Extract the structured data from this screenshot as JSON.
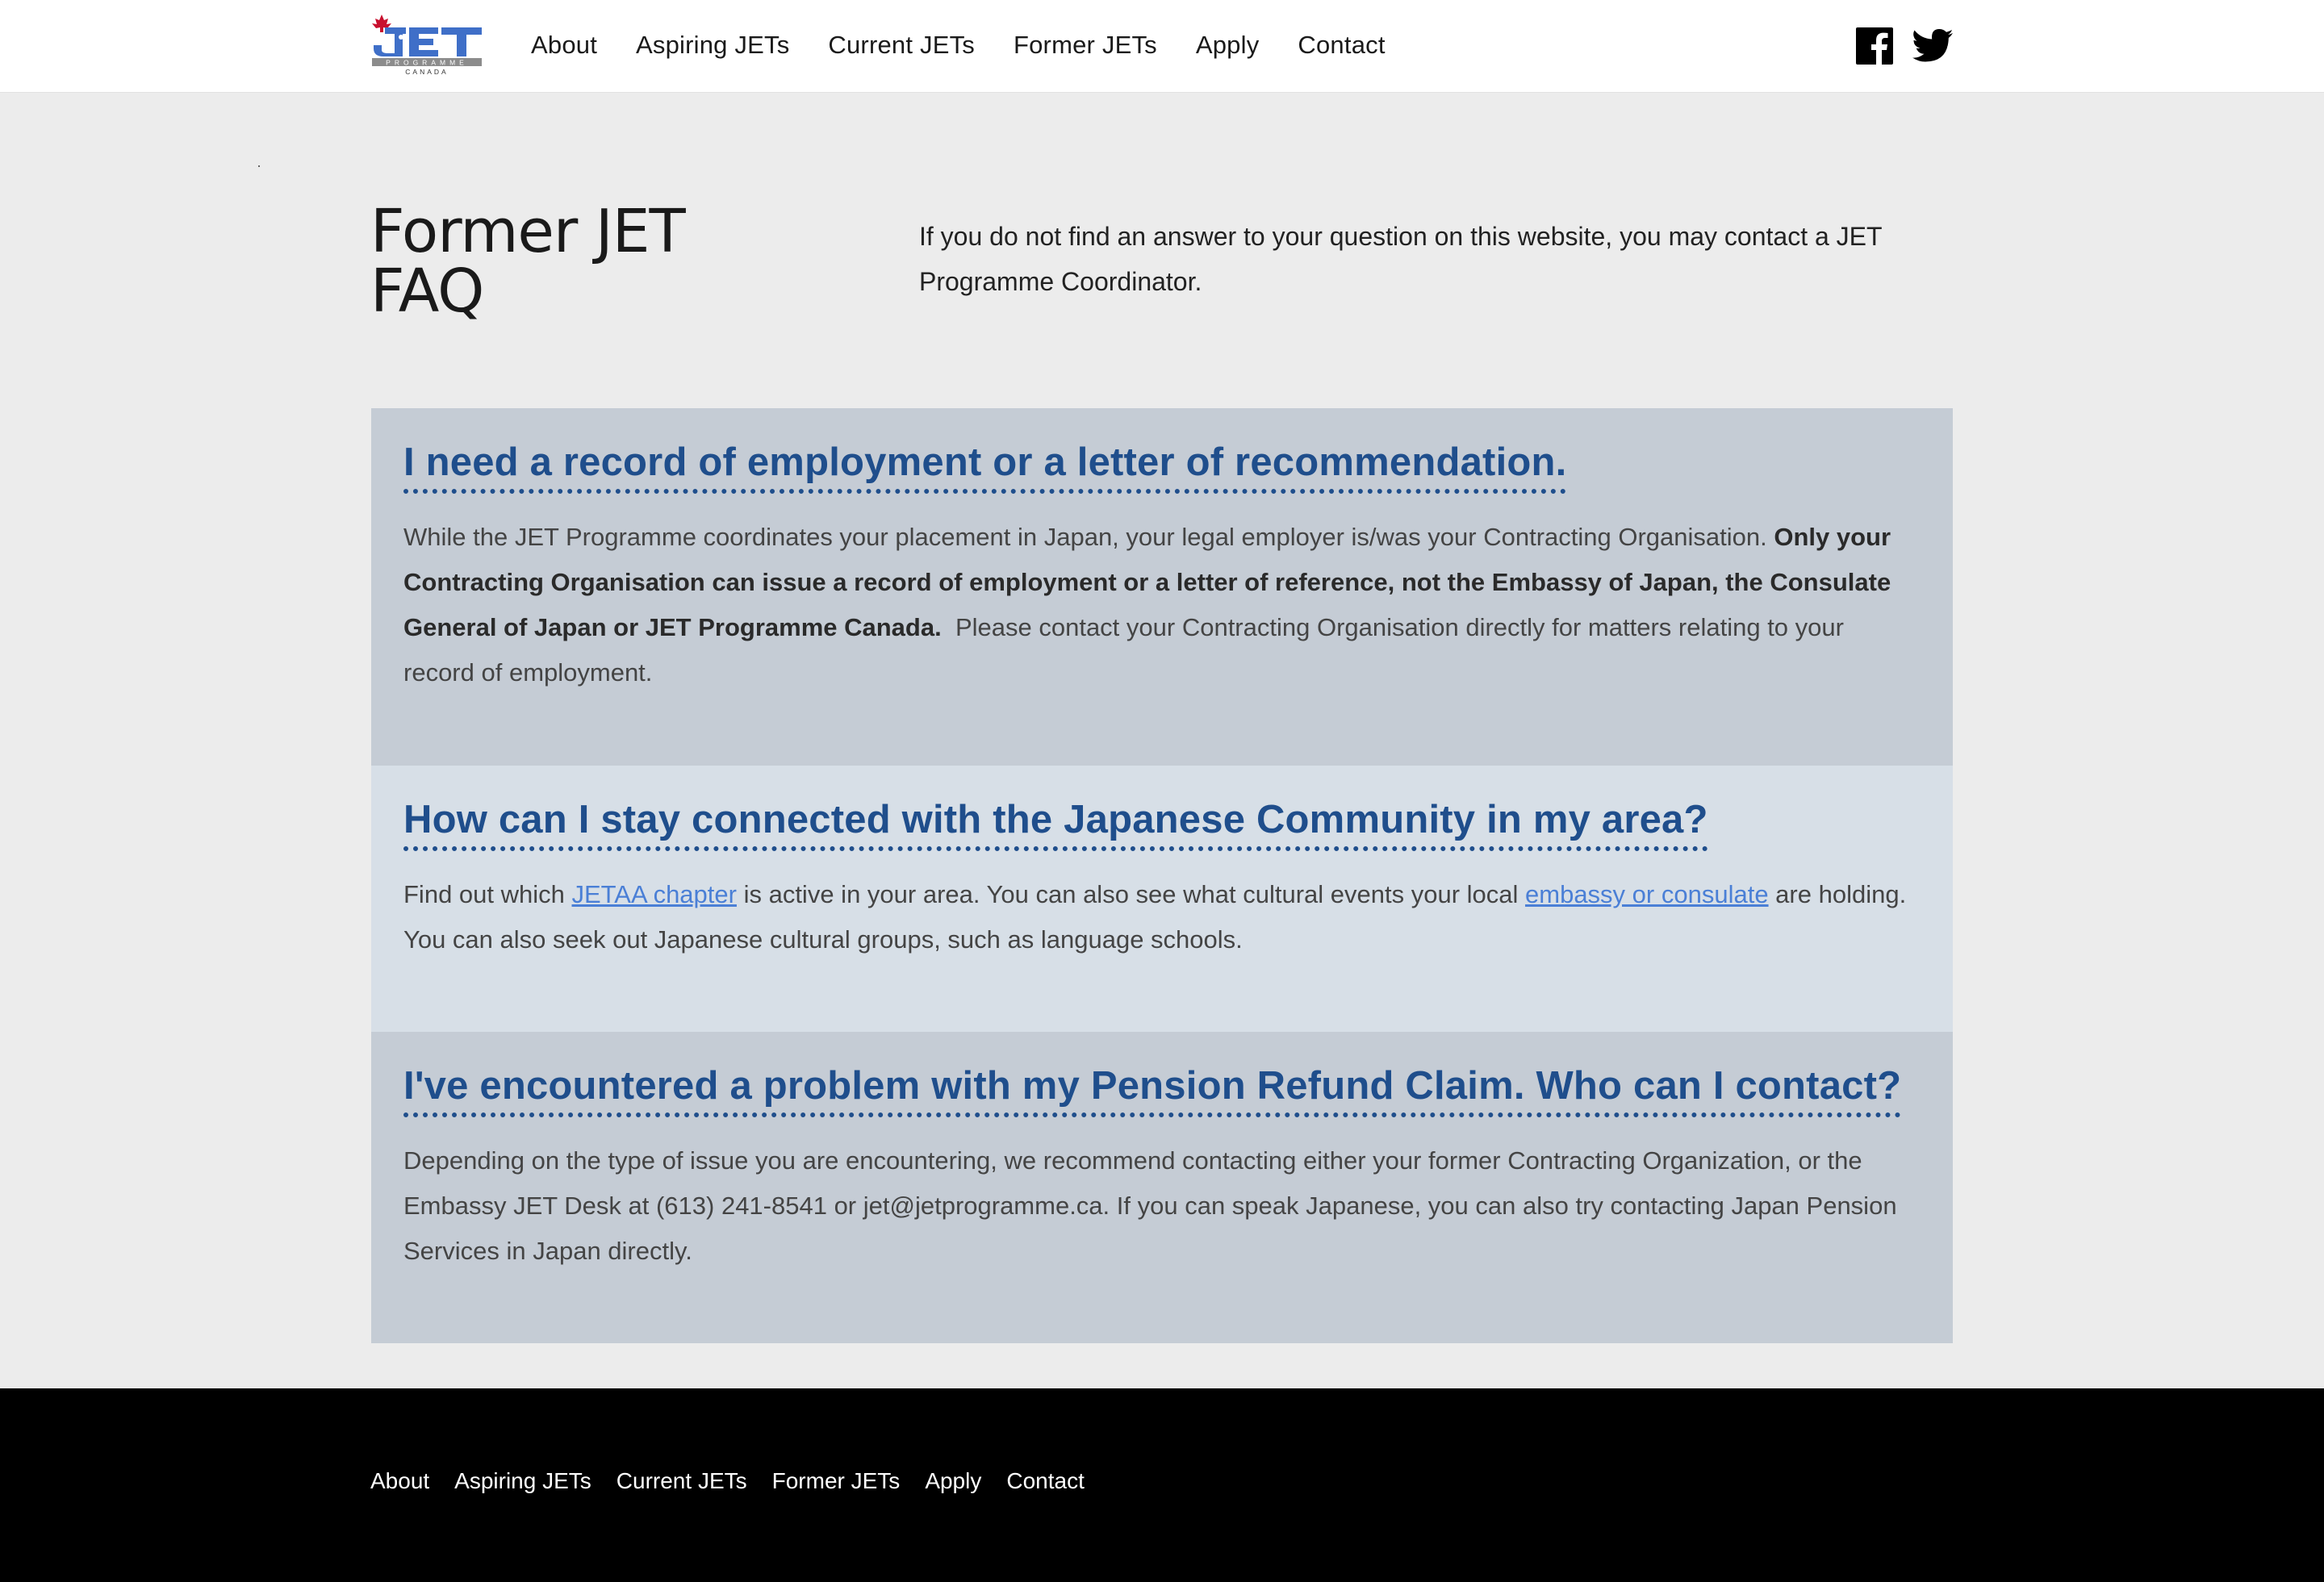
{
  "header": {
    "logo": {
      "wordmark": "JET",
      "sub1": "PROGRAMME",
      "sub2": "CANADA"
    },
    "nav": [
      "About",
      "Aspiring JETs",
      "Current JETs",
      "Former JETs",
      "Apply",
      "Contact"
    ],
    "social": [
      "facebook-icon",
      "twitter-icon"
    ]
  },
  "intro": {
    "title_line1": "Former JET",
    "title_line2": "FAQ",
    "text": "If you do not find an answer to your question on this website, you may contact a JET Programme Coordinator."
  },
  "faq": [
    {
      "question": "I need a record of employment or a letter of recommendation.",
      "a_part1": "While the JET Programme coordinates your placement in Japan, your legal employer is/was your Contracting Organisation. ",
      "a_bold": "Only your Contracting Organisation can issue a record of employment or a letter of reference, not the Embassy of Japan, the Consulate General of Japan or JET Programme Canada.",
      "a_part2": "  Please contact your Contracting Organisation directly for matters relating to your record of employment."
    },
    {
      "question": "How can I stay connected with the Japanese Community in my area?",
      "a_part1": "Find out which ",
      "link1": "JETAA chapter",
      "a_part2": " is active in your area. You can also see what cultural events your local ",
      "link2": "embassy or consulate",
      "a_part3": " are holding. You can also seek out Japanese cultural groups, such as language schools."
    },
    {
      "question": "I've encountered a problem with my Pension Refund Claim. Who can I contact?",
      "answer": "Depending on the type of issue you are encountering, we recommend contacting either your former Contracting Organization, or the Embassy JET Desk at (613) 241-8541 or jet@jetprogramme.ca. If you can speak Japanese, you can also try contacting Japan Pension Services in Japan directly."
    }
  ],
  "footer": {
    "nav": [
      "About",
      "Aspiring JETs",
      "Current JETs",
      "Former JETs",
      "Apply",
      "Contact"
    ]
  },
  "colors": {
    "header_bg": "#ffffff",
    "page_bg": "#ececec",
    "faq_dark": "#c5ccd5",
    "faq_light": "#d7dfe7",
    "question": "#1f4e8c",
    "link": "#4a7fd6",
    "footer_bg": "#000000",
    "logo_blue": "#3f6fc8",
    "maple_red": "#c8102e"
  }
}
